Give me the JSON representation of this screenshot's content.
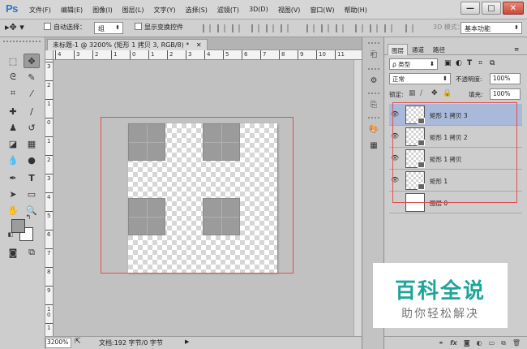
{
  "app": {
    "logo": "Ps",
    "menu": [
      "文件(F)",
      "编辑(E)",
      "图像(I)",
      "图层(L)",
      "文字(Y)",
      "选择(S)",
      "滤镜(T)",
      "3D(D)",
      "视图(V)",
      "窗口(W)",
      "帮助(H)"
    ],
    "window_controls": [
      "—",
      "□",
      "✕"
    ]
  },
  "options_bar": {
    "tool_icon": "move-tool-icon",
    "auto_select_label": "自动选择：",
    "auto_select_value": "组",
    "show_transform_label": "显示变换控件",
    "mode3d_label": "3D 模式：",
    "workspace_value": "基本功能"
  },
  "document": {
    "tab_title": "未标题-1 @ 3200% (矩形 1 拷贝 3, RGB/8) *",
    "ruler_h_labels": [
      "4",
      "3",
      "2",
      "1",
      "0",
      "1",
      "2",
      "3",
      "4",
      "5",
      "6",
      "7",
      "8",
      "9",
      "10",
      "11"
    ],
    "ruler_v_labels": [
      "3",
      "2",
      "1",
      "0",
      "1",
      "2",
      "3",
      "4",
      "5",
      "6",
      "7",
      "8",
      "9",
      "1 0",
      "1"
    ]
  },
  "status": {
    "zoom": "3200%",
    "doc_info": "文档:192 字节/0 字节"
  },
  "layers_panel": {
    "tabs": [
      "图层",
      "通道",
      "路径"
    ],
    "filter_value": "ρ 类型",
    "blend_mode": "正常",
    "opacity_label": "不透明度:",
    "opacity_value": "100%",
    "lock_label": "锁定:",
    "fill_label": "填充:",
    "fill_value": "100%",
    "layers": [
      {
        "name": "矩形 1 拷贝 3",
        "selected": true
      },
      {
        "name": "矩形 1 拷贝 2",
        "selected": false
      },
      {
        "name": "矩形 1 拷贝",
        "selected": false
      },
      {
        "name": "矩形 1",
        "selected": false
      },
      {
        "name": "图层 0",
        "selected": false
      }
    ],
    "bottom_icons": [
      "link-icon",
      "fx-icon",
      "mask-icon",
      "adjustment-icon",
      "group-icon",
      "new-layer-icon",
      "trash-icon"
    ]
  },
  "watermark": {
    "title": "百科全说",
    "subtitle": "助你轻松解决"
  },
  "colors": {
    "selection_outline": "#e05050",
    "selected_layer": "#a8b9d9",
    "watermark_green": "#1ea59a"
  }
}
